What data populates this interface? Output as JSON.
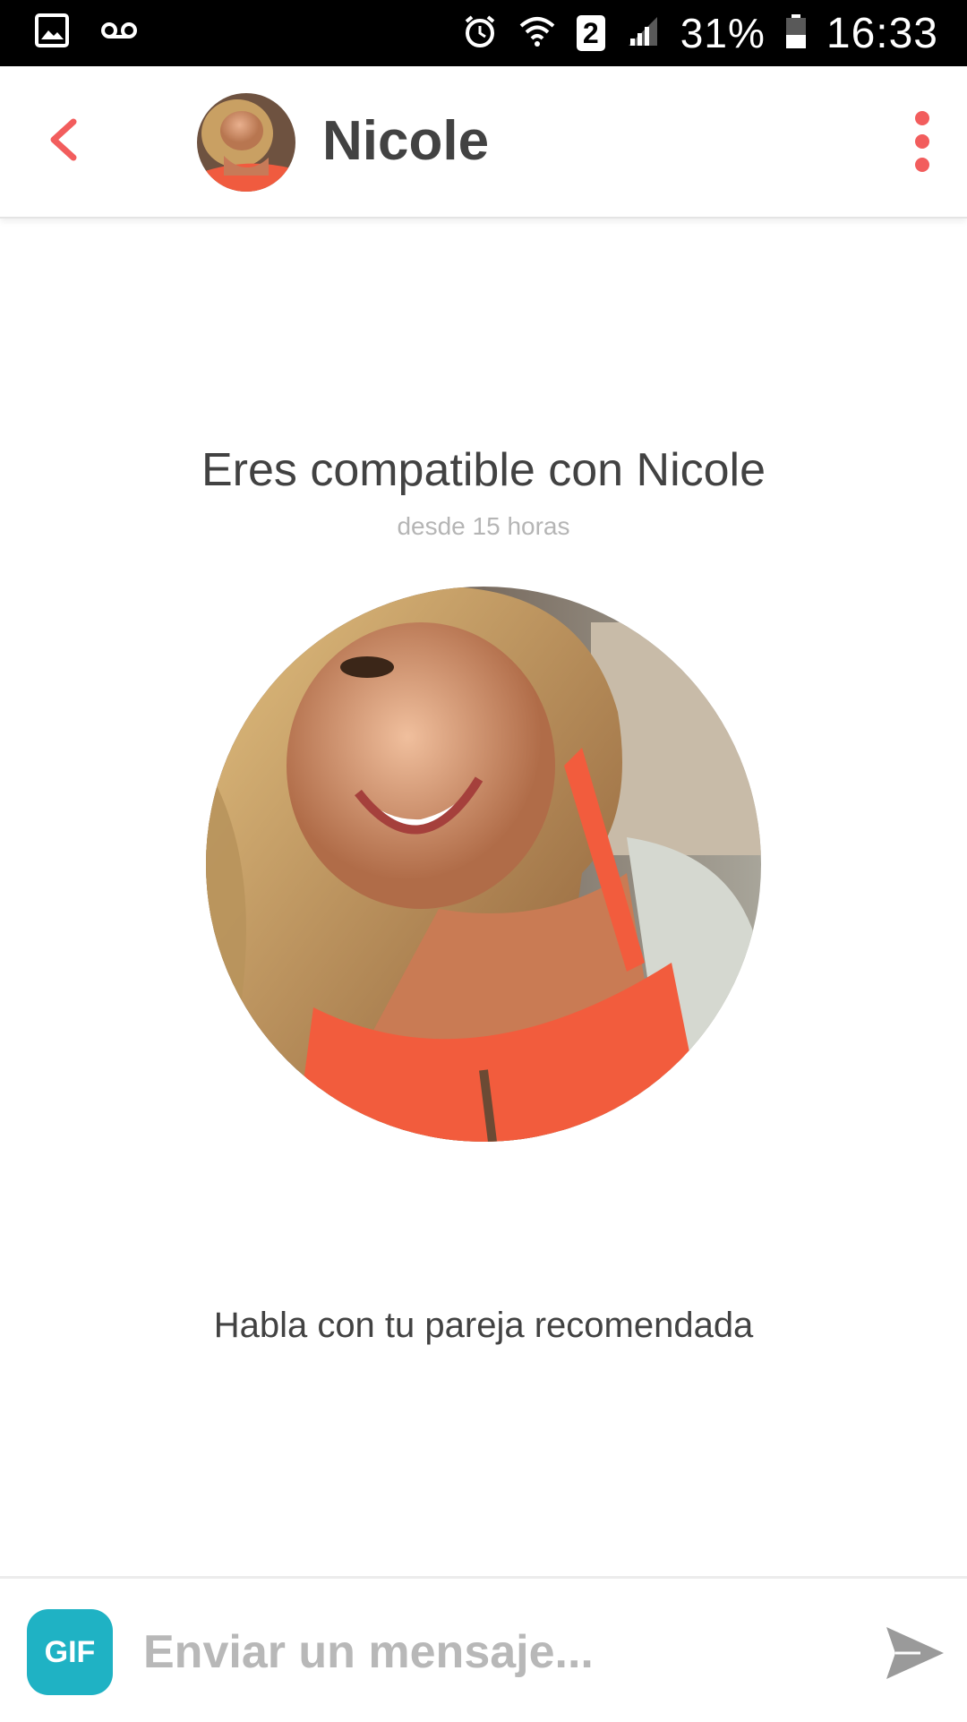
{
  "status_bar": {
    "battery": "31%",
    "time": "16:33",
    "sim_number": "2",
    "icons": [
      "gallery-icon",
      "voicemail-icon",
      "alarm-icon",
      "wifi-icon",
      "sim-icon",
      "signal-icon",
      "battery-icon"
    ]
  },
  "header": {
    "name": "Nicole",
    "back_icon": "chevron-left-icon",
    "menu_icon": "more-vertical-icon",
    "accent_color": "#f25d5d"
  },
  "match": {
    "title": "Eres compatible con Nicole",
    "time": "desde 15 horas",
    "cta": "Habla con tu pareja recomendada"
  },
  "composer": {
    "gif_label": "GIF",
    "placeholder": "Enviar un mensaje...",
    "value": "",
    "send_icon": "send-icon",
    "gif_color": "#1fb2c4"
  }
}
